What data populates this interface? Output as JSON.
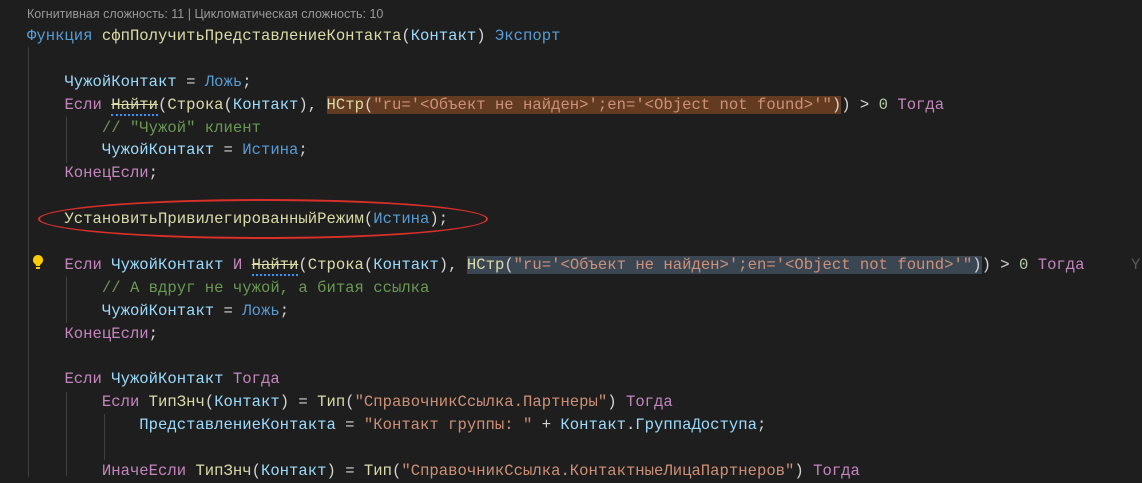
{
  "codelens": "Когнитивная сложность: 11 | Цикломатическая сложность: 10",
  "colors": {
    "background": "#1e1e1e",
    "keyword": "#c586c0",
    "function": "#dcdcaa",
    "variable": "#9cdcfe",
    "literal": "#569cd6",
    "string": "#ce9178",
    "comment": "#6a9955",
    "number": "#b5cea8",
    "find_highlight": "#623b20",
    "selection_highlight": "#3b4653",
    "annotation_ellipse": "#d9302a"
  },
  "icons": {
    "lightbulb": "lightbulb-icon"
  },
  "ghost_text": "Y",
  "lines": [
    {
      "tokens": [
        {
          "t": "Функция ",
          "c": "decl"
        },
        {
          "t": "сфпПолучитьПредставлениеКонтакта",
          "c": "fn"
        },
        {
          "t": "(",
          "c": "p"
        },
        {
          "t": "Контакт",
          "c": "var"
        },
        {
          "t": ") ",
          "c": "p"
        },
        {
          "t": "Экспорт",
          "c": "decl"
        }
      ]
    },
    {
      "tokens": []
    },
    {
      "tokens": [
        {
          "t": "    ",
          "c": "p"
        },
        {
          "t": "ЧужойКонтакт",
          "c": "var"
        },
        {
          "t": " = ",
          "c": "p"
        },
        {
          "t": "Ложь",
          "c": "lit"
        },
        {
          "t": ";",
          "c": "p"
        }
      ]
    },
    {
      "tokens": [
        {
          "t": "    ",
          "c": "p"
        },
        {
          "t": "Если ",
          "c": "kw"
        },
        {
          "t": "Найти",
          "c": "fn squig"
        },
        {
          "t": "(",
          "c": "p"
        },
        {
          "t": "Строка",
          "c": "fn"
        },
        {
          "t": "(",
          "c": "p"
        },
        {
          "t": "Контакт",
          "c": "var"
        },
        {
          "t": "), ",
          "c": "p"
        },
        {
          "t": "НСтр",
          "c": "fn hl-find"
        },
        {
          "t": "(",
          "c": "p hl-find"
        },
        {
          "t": "\"ru='<Объект не найден>';en='<Object not found>'\"",
          "c": "str hl-find"
        },
        {
          "t": ")",
          "c": "p hl-find"
        },
        {
          "t": ") > ",
          "c": "p"
        },
        {
          "t": "0",
          "c": "num"
        },
        {
          "t": " ",
          "c": "p"
        },
        {
          "t": "Тогда",
          "c": "kw"
        }
      ]
    },
    {
      "tokens": [
        {
          "t": "        ",
          "c": "p"
        },
        {
          "t": "// \"Чужой\" клиент",
          "c": "cm"
        }
      ]
    },
    {
      "tokens": [
        {
          "t": "        ",
          "c": "p"
        },
        {
          "t": "ЧужойКонтакт",
          "c": "var"
        },
        {
          "t": " = ",
          "c": "p"
        },
        {
          "t": "Истина",
          "c": "lit"
        },
        {
          "t": ";",
          "c": "p"
        }
      ]
    },
    {
      "tokens": [
        {
          "t": "    ",
          "c": "p"
        },
        {
          "t": "КонецЕсли",
          "c": "kw"
        },
        {
          "t": ";",
          "c": "p"
        }
      ]
    },
    {
      "tokens": []
    },
    {
      "tokens": [
        {
          "t": "    ",
          "c": "p"
        },
        {
          "t": "УстановитьПривилегированныйРежим",
          "c": "fn"
        },
        {
          "t": "(",
          "c": "p"
        },
        {
          "t": "Истина",
          "c": "lit"
        },
        {
          "t": ");",
          "c": "p"
        }
      ]
    },
    {
      "tokens": []
    },
    {
      "tokens": [
        {
          "t": "    ",
          "c": "p"
        },
        {
          "t": "Если ",
          "c": "kw"
        },
        {
          "t": "ЧужойКонтакт",
          "c": "var"
        },
        {
          "t": " И ",
          "c": "kw"
        },
        {
          "t": "Найти",
          "c": "fn squig"
        },
        {
          "t": "(",
          "c": "p"
        },
        {
          "t": "Строка",
          "c": "fn"
        },
        {
          "t": "(",
          "c": "p"
        },
        {
          "t": "Контакт",
          "c": "var"
        },
        {
          "t": "), ",
          "c": "p"
        },
        {
          "t": "НСтр",
          "c": "fn hl-sel"
        },
        {
          "t": "(",
          "c": "p hl-sel"
        },
        {
          "t": "\"ru='<Объект не найден>';en='<Object not found>'\"",
          "c": "str hl-sel"
        },
        {
          "t": ")",
          "c": "p hl-sel"
        },
        {
          "t": ") > ",
          "c": "p"
        },
        {
          "t": "0",
          "c": "num"
        },
        {
          "t": " ",
          "c": "p"
        },
        {
          "t": "Тогда",
          "c": "kw"
        }
      ]
    },
    {
      "tokens": [
        {
          "t": "        ",
          "c": "p"
        },
        {
          "t": "// А вдруг не чужой, а битая ссылка",
          "c": "cm"
        }
      ]
    },
    {
      "tokens": [
        {
          "t": "        ",
          "c": "p"
        },
        {
          "t": "ЧужойКонтакт",
          "c": "var"
        },
        {
          "t": " = ",
          "c": "p"
        },
        {
          "t": "Ложь",
          "c": "lit"
        },
        {
          "t": ";",
          "c": "p"
        }
      ]
    },
    {
      "tokens": [
        {
          "t": "    ",
          "c": "p"
        },
        {
          "t": "КонецЕсли",
          "c": "kw"
        },
        {
          "t": ";",
          "c": "p"
        }
      ]
    },
    {
      "tokens": []
    },
    {
      "tokens": [
        {
          "t": "    ",
          "c": "p"
        },
        {
          "t": "Если ",
          "c": "kw"
        },
        {
          "t": "ЧужойКонтакт",
          "c": "var"
        },
        {
          "t": " ",
          "c": "p"
        },
        {
          "t": "Тогда",
          "c": "kw"
        }
      ]
    },
    {
      "tokens": [
        {
          "t": "        ",
          "c": "p"
        },
        {
          "t": "Если ",
          "c": "kw"
        },
        {
          "t": "ТипЗнч",
          "c": "fn"
        },
        {
          "t": "(",
          "c": "p"
        },
        {
          "t": "Контакт",
          "c": "var"
        },
        {
          "t": ") = ",
          "c": "p"
        },
        {
          "t": "Тип",
          "c": "fn"
        },
        {
          "t": "(",
          "c": "p"
        },
        {
          "t": "\"СправочникСсылка.Партнеры\"",
          "c": "str"
        },
        {
          "t": ") ",
          "c": "p"
        },
        {
          "t": "Тогда",
          "c": "kw"
        }
      ]
    },
    {
      "tokens": [
        {
          "t": "            ",
          "c": "p"
        },
        {
          "t": "ПредставлениеКонтакта",
          "c": "var"
        },
        {
          "t": " = ",
          "c": "p"
        },
        {
          "t": "\"Контакт группы: \"",
          "c": "str"
        },
        {
          "t": " + ",
          "c": "p"
        },
        {
          "t": "Контакт",
          "c": "var"
        },
        {
          "t": ".",
          "c": "p"
        },
        {
          "t": "ГруппаДоступа",
          "c": "var"
        },
        {
          "t": ";",
          "c": "p"
        }
      ]
    },
    {
      "tokens": []
    },
    {
      "tokens": [
        {
          "t": "        ",
          "c": "p"
        },
        {
          "t": "ИначеЕсли ",
          "c": "kw"
        },
        {
          "t": "ТипЗнч",
          "c": "fn"
        },
        {
          "t": "(",
          "c": "p"
        },
        {
          "t": "Контакт",
          "c": "var"
        },
        {
          "t": ") = ",
          "c": "p"
        },
        {
          "t": "Тип",
          "c": "fn"
        },
        {
          "t": "(",
          "c": "p"
        },
        {
          "t": "\"СправочникСсылка.КонтактныеЛицаПартнеров\"",
          "c": "str"
        },
        {
          "t": ") ",
          "c": "p"
        },
        {
          "t": "Тогда",
          "c": "kw"
        }
      ]
    }
  ]
}
